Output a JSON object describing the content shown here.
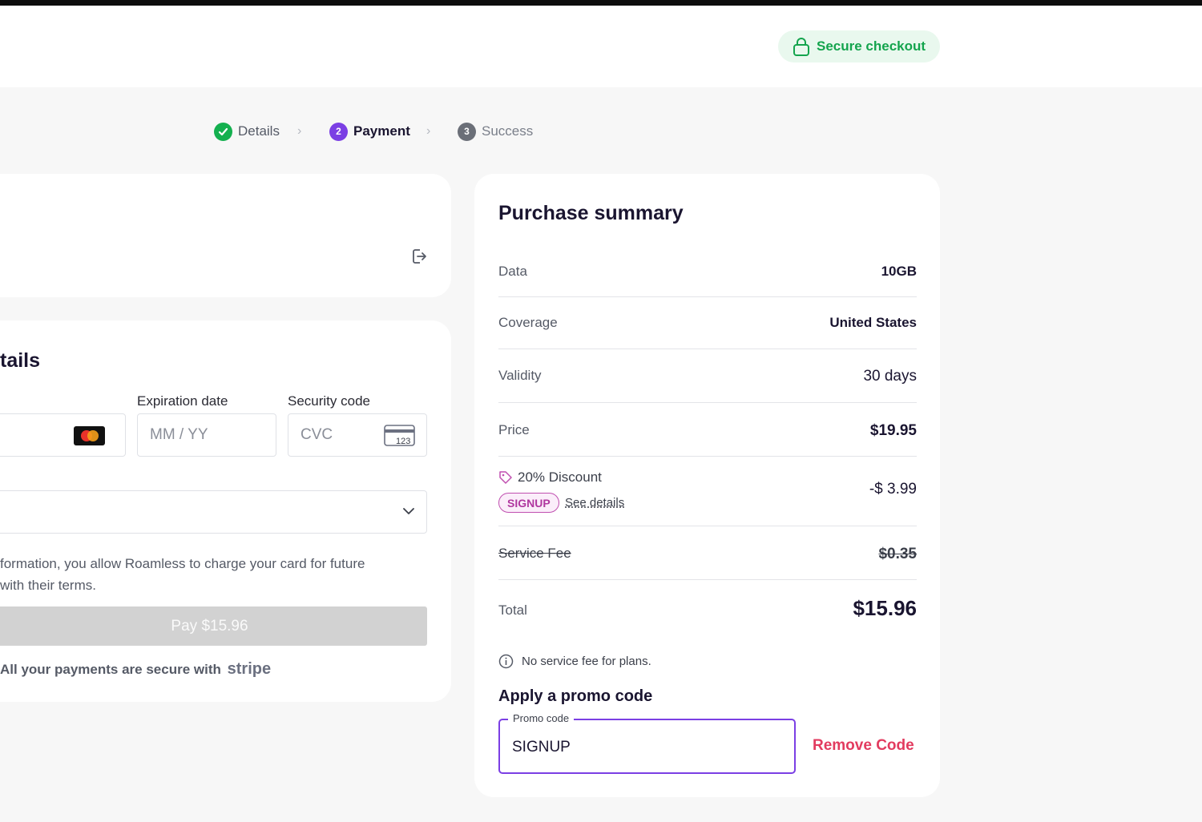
{
  "header": {
    "secure_label": "Secure checkout"
  },
  "steps": [
    {
      "label": "Details",
      "state": "done"
    },
    {
      "label": "Payment",
      "number": "2",
      "state": "current"
    },
    {
      "label": "Success",
      "number": "3",
      "state": "upcoming"
    }
  ],
  "payment": {
    "title": "tails",
    "expiration_label": "Expiration date",
    "expiration_placeholder": "MM / YY",
    "security_label": "Security code",
    "security_placeholder": "CVC",
    "card_brand": "mastercard",
    "cvc_icon_text": "123",
    "consent_line1": "formation, you allow Roamless to charge your card for future",
    "consent_line2": " with their terms.",
    "pay_button": "Pay $15.96",
    "secure_note": "All your payments are secure with",
    "stripe_label": "stripe"
  },
  "summary": {
    "title": "Purchase summary",
    "rows": {
      "data": {
        "label": "Data",
        "value": "10GB"
      },
      "coverage": {
        "label": "Coverage",
        "value": "United States"
      },
      "validity": {
        "label": "Validity",
        "value": "30 days"
      },
      "price": {
        "label": "Price",
        "value": "$19.95"
      },
      "discount": {
        "label": "20% Discount",
        "value": "-$ 3.99",
        "tag": "SIGNUP",
        "link": "See details"
      },
      "fee": {
        "label": "Service Fee",
        "value": "$0.35"
      },
      "total": {
        "label": "Total",
        "value": "$15.96"
      }
    },
    "info_note": "No service fee for plans.",
    "promo_title": "Apply a promo code",
    "promo_legend": "Promo code",
    "promo_value": "SIGNUP",
    "remove_code": "Remove Code"
  },
  "colors": {
    "accent": "#7b3fe4",
    "success": "#14b04f",
    "danger": "#e23b5f",
    "tag": "#b0379f"
  }
}
